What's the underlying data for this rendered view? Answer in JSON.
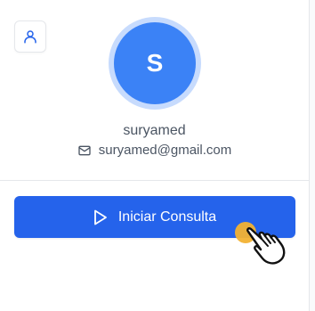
{
  "profile": {
    "avatar_initial": "S",
    "username": "suryamed",
    "email": "suryamed@gmail.com"
  },
  "actions": {
    "start_label": "Iniciar Consulta"
  },
  "icons": {
    "profile_button": "user-icon",
    "email": "mail-icon",
    "start": "play-icon",
    "cursor": "pointer-hand-icon"
  },
  "colors": {
    "primary": "#2563eb",
    "avatar": "#3b82f6",
    "avatar_ring": "#c7dbfd",
    "cursor_highlight": "#f2b233",
    "text_muted": "#4b5563",
    "border": "#e5e7eb"
  }
}
